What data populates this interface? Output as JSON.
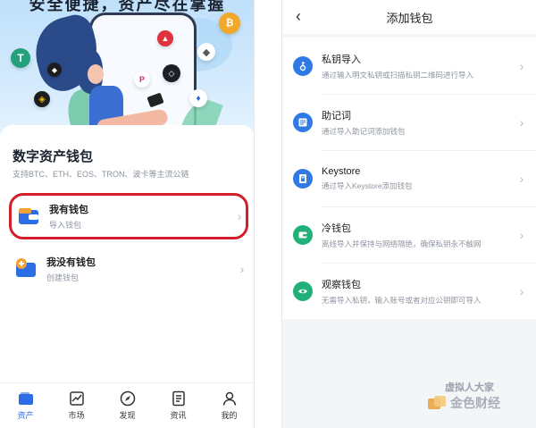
{
  "left": {
    "hero": {
      "cut_title": "安全便捷，资产尽在掌握",
      "coins": [
        "bitcoin-icon",
        "tron-icon",
        "ethereum-icon",
        "tezos-icon",
        "binance-icon",
        "polkadot-icon",
        "eos-icon",
        "huobi-icon",
        "ethereum-classic-icon"
      ]
    },
    "card": {
      "title": "数字资产钱包",
      "subtitle": "支持BTC、ETH、EOS、TRON、波卡等主流公链",
      "options": [
        {
          "title": "我有钱包",
          "desc": "导入钱包",
          "highlight_color": "#d21f2b"
        },
        {
          "title": "我没有钱包",
          "desc": "创建钱包"
        }
      ]
    },
    "tabs": [
      {
        "label": "资产",
        "icon": "wallet-icon",
        "active": true
      },
      {
        "label": "市场",
        "icon": "chart-icon",
        "active": false
      },
      {
        "label": "发现",
        "icon": "compass-icon",
        "active": false
      },
      {
        "label": "资讯",
        "icon": "news-icon",
        "active": false
      },
      {
        "label": "我的",
        "icon": "user-icon",
        "active": false
      }
    ]
  },
  "right": {
    "nav": {
      "title": "添加钱包",
      "back_icon": "chevron-left-icon"
    },
    "options": [
      {
        "title": "私钥导入",
        "desc": "通过输入明文私钥或扫描私钥二维码进行导入",
        "icon": "key-icon",
        "color": "#2f7ae5"
      },
      {
        "title": "助记词",
        "desc": "通过导入助记词添加钱包",
        "icon": "note-icon",
        "color": "#2f7ae5"
      },
      {
        "title": "Keystore",
        "desc": "通过导入Keystore添加钱包",
        "icon": "file-lock-icon",
        "color": "#2f7ae5"
      },
      {
        "title": "冷钱包",
        "desc": "离线导入并保持与网络隔绝，确保私钥永不触网",
        "icon": "cold-wallet-icon",
        "color": "#22b07a"
      },
      {
        "title": "观察钱包",
        "desc": "无需导入私钥，输入账号或者对应公钥即可导入",
        "icon": "eye-icon",
        "color": "#22b07a"
      }
    ]
  },
  "watermark": {
    "line1": "虚拟人大家",
    "line2": "金色财经"
  },
  "colors": {
    "accent": "#2b6de5",
    "green": "#22b07a",
    "highlight": "#d21f2b"
  }
}
